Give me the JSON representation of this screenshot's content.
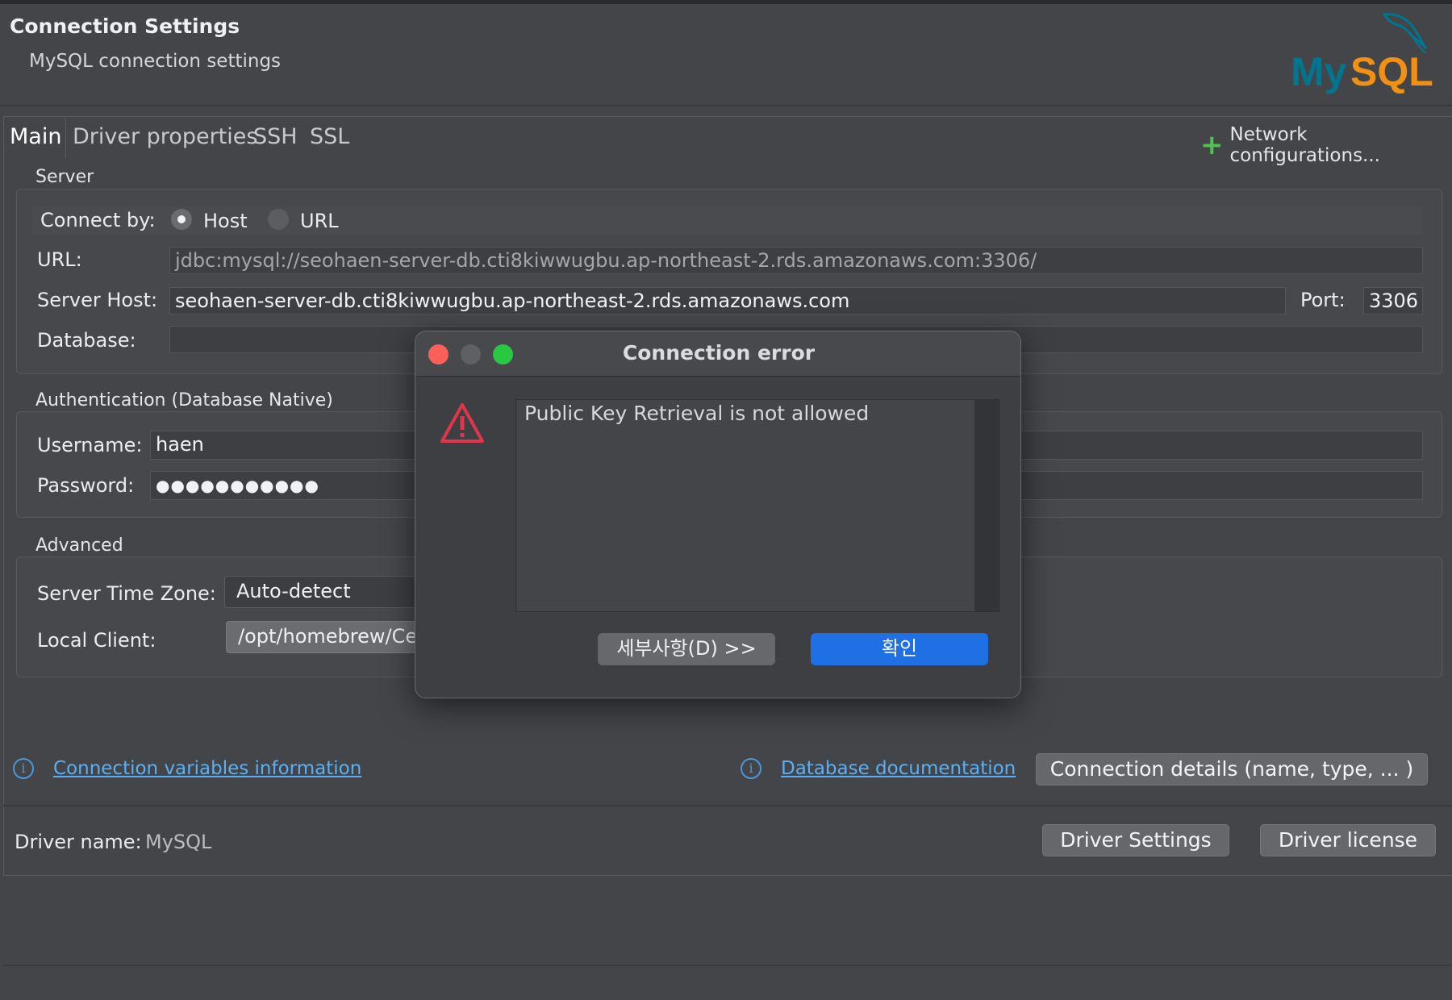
{
  "header": {
    "title": "Connection Settings",
    "subtitle": "MySQL connection settings",
    "logo_text": "MySQL"
  },
  "tabs": [
    {
      "label": "Main",
      "active": true
    },
    {
      "label": "Driver properties",
      "active": false
    },
    {
      "label": "SSH",
      "active": false
    },
    {
      "label": "SSL",
      "active": false
    }
  ],
  "network_config_label": "Network configurations...",
  "server": {
    "section_label": "Server",
    "connect_by_label": "Connect by:",
    "options": [
      "Host",
      "URL"
    ],
    "selected": "Host",
    "url_label": "URL:",
    "url_value": "jdbc:mysql://seohaen-server-db.cti8kiwwugbu.ap-northeast-2.rds.amazonaws.com:3306/",
    "host_label": "Server Host:",
    "host_value": "seohaen-server-db.cti8kiwwugbu.ap-northeast-2.rds.amazonaws.com",
    "port_label": "Port:",
    "port_value": "3306",
    "database_label": "Database:",
    "database_value": ""
  },
  "auth": {
    "section_label": "Authentication (Database Native)",
    "username_label": "Username:",
    "username_value": "haen",
    "password_label": "Password:",
    "password_value": "●●●●●●●●●●●"
  },
  "advanced": {
    "section_label": "Advanced",
    "timezone_label": "Server Time Zone:",
    "timezone_value": "Auto-detect",
    "local_client_label": "Local Client:",
    "local_client_value": "/opt/homebrew/Ce"
  },
  "footer": {
    "conn_vars_link": "Connection variables information",
    "db_docs_link": "Database documentation",
    "conn_details_button": "Connection details (name, type, ... )",
    "driver_name_label": "Driver name:",
    "driver_name_value": "MySQL",
    "driver_settings_button": "Driver Settings",
    "driver_license_button": "Driver license"
  },
  "dialog": {
    "title": "Connection error",
    "message": "Public Key Retrieval is not allowed",
    "details_button": "세부사항(D) >>",
    "ok_button": "확인"
  },
  "colors": {
    "accent_blue": "#1f6fe5",
    "traffic_close": "#fe5f57",
    "traffic_min": "#5f6064",
    "traffic_max": "#28c840",
    "warning_red": "#e0364a",
    "mysql_teal": "#00758f",
    "mysql_orange": "#f29111"
  }
}
